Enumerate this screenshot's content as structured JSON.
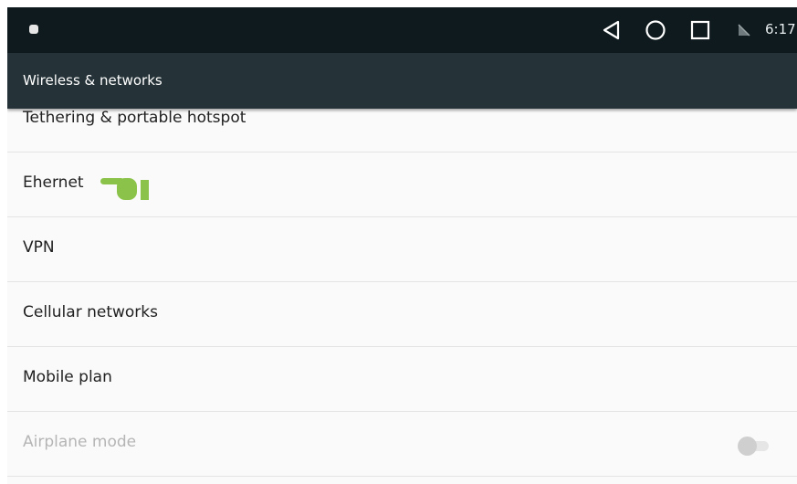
{
  "status_bar": {
    "time": "6:17",
    "left_icon": "notification-icon",
    "nav_icons": [
      "back-icon",
      "home-icon",
      "recents-icon"
    ],
    "signal_icon": "no-sim-icon"
  },
  "toolbar": {
    "title": "Wireless & networks"
  },
  "settings": {
    "items": [
      {
        "label": "Tethering & portable hotspot"
      },
      {
        "label": "Ehernet"
      },
      {
        "label": "VPN"
      },
      {
        "label": "Cellular networks"
      },
      {
        "label": "Mobile plan"
      },
      {
        "label": "Airplane mode",
        "enabled": false,
        "toggle_on": false
      }
    ]
  },
  "colors": {
    "status_bar_bg": "#0f1a1e",
    "toolbar_bg": "#253338",
    "list_bg": "#fafafa",
    "pointer_green": "#8bc34a"
  }
}
